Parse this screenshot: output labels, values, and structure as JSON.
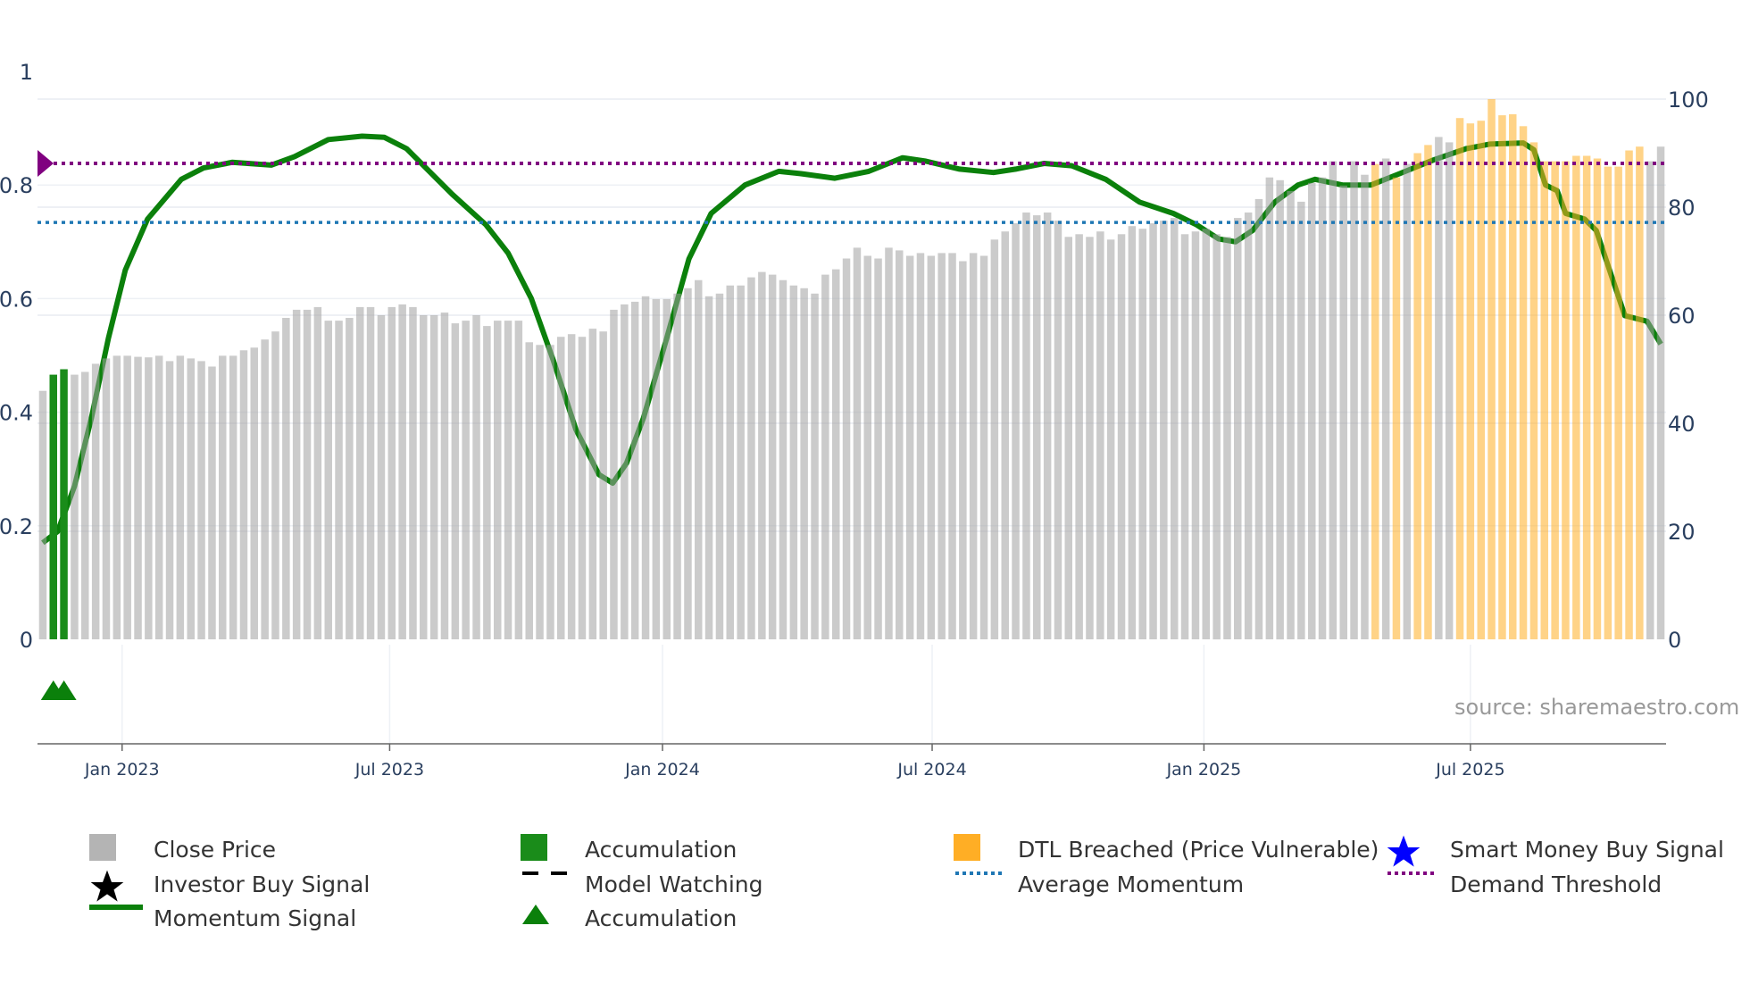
{
  "chart_data": {
    "type": "bar",
    "title": "",
    "left_axis": {
      "ticks": [
        "0",
        "0.2",
        "0.4",
        "0.6",
        "0.8",
        "1"
      ],
      "range": [
        0,
        1
      ]
    },
    "right_axis": {
      "ticks": [
        "0",
        "20",
        "40",
        "60",
        "80",
        "100"
      ],
      "range": [
        0,
        100
      ]
    },
    "x_ticks": [
      {
        "label": "Jan 2023",
        "index": 7.5
      },
      {
        "label": "Jul 2023",
        "index": 32.8
      },
      {
        "label": "Jan 2024",
        "index": 58.6
      },
      {
        "label": "Jul 2024",
        "index": 84.1
      },
      {
        "label": "Jan 2025",
        "index": 109.8
      },
      {
        "label": "Jul 2025",
        "index": 135.0
      }
    ],
    "close_price": [
      46,
      49,
      50,
      49,
      49.5,
      51,
      52,
      52.5,
      52.5,
      52.3,
      52.2,
      52.5,
      51.5,
      52.5,
      52,
      51.5,
      50.5,
      52.5,
      52.5,
      53.5,
      54,
      55.5,
      57,
      59.5,
      61,
      61,
      61.5,
      59,
      59,
      59.5,
      61.5,
      61.5,
      60,
      61.5,
      62,
      61.5,
      60,
      60,
      60.5,
      58.5,
      59,
      60,
      58,
      59,
      59,
      59,
      55,
      54.5,
      54.5,
      56,
      56.5,
      56,
      57.5,
      57,
      61,
      62,
      62.5,
      63.5,
      63,
      63,
      64,
      65,
      66.5,
      63.5,
      64,
      65.5,
      65.5,
      67,
      68,
      67.5,
      66.5,
      65.5,
      65,
      64,
      67.5,
      68.5,
      70.5,
      72.5,
      71,
      70.5,
      72.5,
      72,
      71,
      71.5,
      71,
      71.5,
      71.5,
      70,
      71.5,
      71,
      74,
      75.5,
      77,
      79,
      78.5,
      79,
      77.5,
      74.5,
      75,
      74.5,
      75.5,
      74,
      75,
      76.5,
      76,
      77,
      77.5,
      78,
      75,
      75.5,
      76,
      75,
      74.5,
      78,
      79,
      81.5,
      85.5,
      85,
      83,
      81,
      84.5,
      85.5,
      88.5,
      84,
      88.5,
      86,
      88,
      89,
      85.5,
      88,
      90,
      91.5,
      93,
      92,
      96.5,
      95.5,
      96,
      100,
      97,
      97.2,
      95,
      92,
      88.5,
      88.5,
      88.5,
      89.5,
      89.5,
      89,
      87.5,
      87.5,
      90.5,
      91.2,
      88.5,
      91.2
    ],
    "bar_state": "g=close price, a=accumulation, d=DTL breached",
    "bar_states": "gaagggggggggggggggggggggggggggggggggggggggggggggggggggggggggggggggggggggggggggggggggggggggggggggggggggggggggggggggggggggggggggdgdgddggddddddddddddddddddggdddd",
    "momentum": [
      [
        0,
        0.17
      ],
      [
        1.4,
        0.19
      ],
      [
        3,
        0.27
      ],
      [
        4.6,
        0.39
      ],
      [
        6.2,
        0.53
      ],
      [
        7.8,
        0.65
      ],
      [
        9.9,
        0.74
      ],
      [
        13.1,
        0.81
      ],
      [
        15.2,
        0.83
      ],
      [
        17.9,
        0.84
      ],
      [
        21.6,
        0.835
      ],
      [
        23.8,
        0.85
      ],
      [
        27,
        0.88
      ],
      [
        30.2,
        0.886
      ],
      [
        32.3,
        0.884
      ],
      [
        34.4,
        0.864
      ],
      [
        38.7,
        0.784
      ],
      [
        41.9,
        0.73
      ],
      [
        44,
        0.68
      ],
      [
        46.2,
        0.6
      ],
      [
        48.3,
        0.49
      ],
      [
        50.4,
        0.37
      ],
      [
        52.6,
        0.29
      ],
      [
        53.9,
        0.275
      ],
      [
        55.2,
        0.31
      ],
      [
        56.8,
        0.39
      ],
      [
        59,
        0.53
      ],
      [
        61.1,
        0.67
      ],
      [
        63.2,
        0.75
      ],
      [
        66.4,
        0.8
      ],
      [
        69.6,
        0.824
      ],
      [
        71.7,
        0.82
      ],
      [
        74.9,
        0.812
      ],
      [
        78.1,
        0.824
      ],
      [
        81.3,
        0.848
      ],
      [
        83.5,
        0.842
      ],
      [
        86.7,
        0.828
      ],
      [
        89.9,
        0.822
      ],
      [
        92,
        0.828
      ],
      [
        94.7,
        0.838
      ],
      [
        97.3,
        0.834
      ],
      [
        100.5,
        0.81
      ],
      [
        103.7,
        0.77
      ],
      [
        106.9,
        0.75
      ],
      [
        109.1,
        0.73
      ],
      [
        111.2,
        0.705
      ],
      [
        112.8,
        0.7
      ],
      [
        114.4,
        0.72
      ],
      [
        116.5,
        0.77
      ],
      [
        118.7,
        0.8
      ],
      [
        120.3,
        0.81
      ],
      [
        122.9,
        0.8
      ],
      [
        125.6,
        0.8
      ],
      [
        128.3,
        0.82
      ],
      [
        131.5,
        0.844
      ],
      [
        134.6,
        0.864
      ],
      [
        136.8,
        0.872
      ],
      [
        140,
        0.874
      ],
      [
        141,
        0.862
      ],
      [
        142.1,
        0.8
      ],
      [
        143.2,
        0.79
      ],
      [
        144,
        0.75
      ],
      [
        145.8,
        0.74
      ],
      [
        146.9,
        0.72
      ],
      [
        149.6,
        0.57
      ],
      [
        151.7,
        0.56
      ],
      [
        153,
        0.52
      ]
    ],
    "demand_threshold": 0.838,
    "average_momentum": 0.734,
    "accumulation_markers": [
      1,
      2
    ],
    "colors": {
      "close": "#b4b4b4",
      "accumulation": "#1a8c1a",
      "dtl": "#ffae25",
      "momentum": "#0b800b",
      "avg": "#1f77b4",
      "demand": "#800080",
      "smart_money": "#0000ff",
      "investor": "#000000"
    },
    "legend": [
      {
        "label": "Close Price",
        "icon": "gray-square"
      },
      {
        "label": "Accumulation",
        "icon": "green-square"
      },
      {
        "label": "DTL Breached (Price Vulnerable)",
        "icon": "orange-square"
      },
      {
        "label": "Smart Money Buy Signal",
        "icon": "blue-star"
      },
      {
        "label": "Investor Buy Signal",
        "icon": "black-star"
      },
      {
        "label": "Model Watching",
        "icon": "black-dash"
      },
      {
        "label": "Average Momentum",
        "icon": "blue-dot-line"
      },
      {
        "label": "Demand Threshold",
        "icon": "purple-dot-line"
      },
      {
        "label": "Momentum Signal",
        "icon": "green-line"
      },
      {
        "label": "Accumulation",
        "icon": "green-triangle"
      }
    ],
    "source": "source: sharemaestro.com"
  }
}
